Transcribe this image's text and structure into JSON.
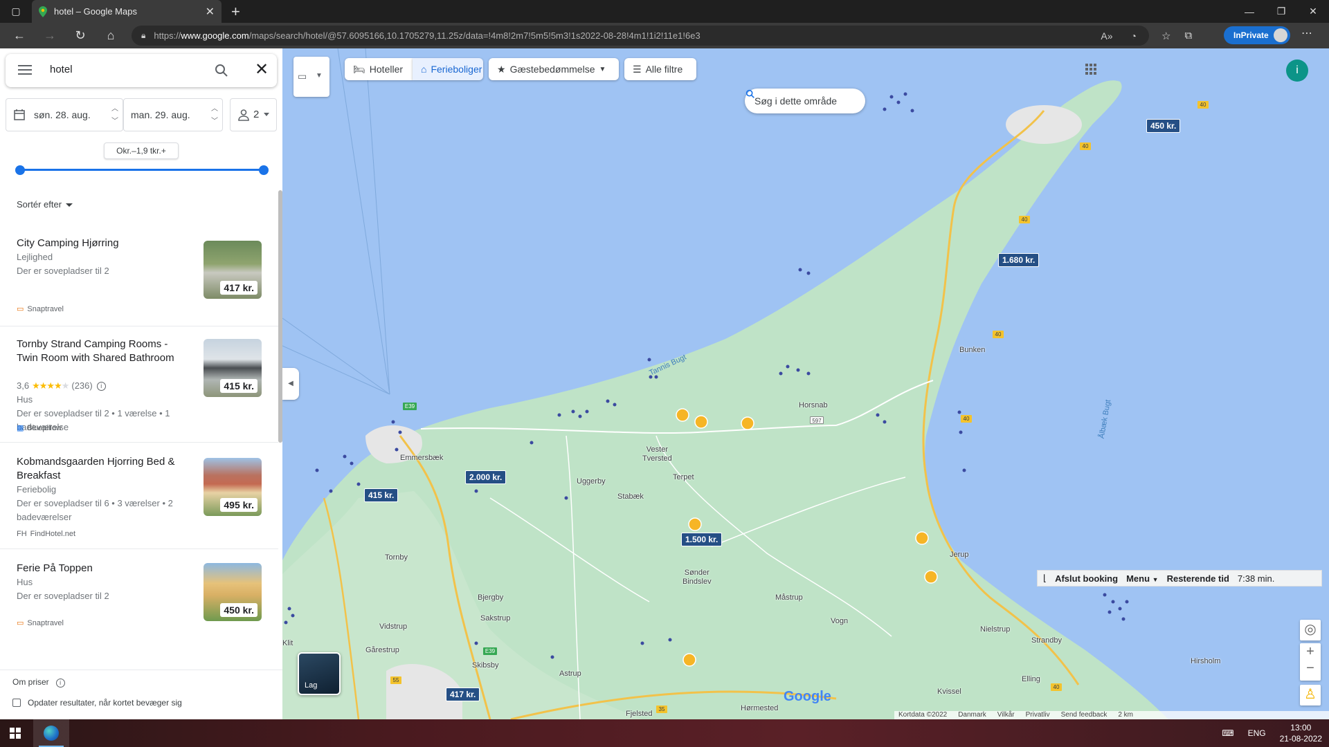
{
  "browser": {
    "tab_title": "hotel – Google Maps",
    "url_prefix": "https://",
    "url_host": "www.google.com",
    "url_path": "/maps/search/hotel/@57.6095166,10.1705279,11.25z/data=!4m8!2m7!5m5!5m3!1s2022-08-28!4m1!1i2!11e1!6e3",
    "inprivate_label": "InPrivate"
  },
  "search": {
    "query": "hotel"
  },
  "dates": {
    "checkin": "søn. 28. aug.",
    "checkout": "man. 29. aug.",
    "guests": "2"
  },
  "price_filter": {
    "label": "Okr.–1,9 tkr.+"
  },
  "sort": {
    "label": "Sortér efter"
  },
  "listings": [
    {
      "name": "City Camping Hjørring",
      "type": "Lejlighed",
      "details": "Der er sovepladser til 2",
      "price": "417 kr.",
      "source": "Snaptravel"
    },
    {
      "name": "Tornby Strand Camping Rooms - Twin Room with Shared Bathroom",
      "rating": "3,6",
      "reviews": "(236)",
      "type": "Hus",
      "details": "Der er sovepladser til 2 • 1 værelse • 1 badeværelse",
      "price": "415 kr.",
      "source": "Bluepillow"
    },
    {
      "name": "Kobmandsgaarden Hjorring Bed & Breakfast",
      "type": "Feriebolig",
      "details": "Der er sovepladser til 6 • 3 værelser • 2 badeværelser",
      "price": "495 kr.",
      "source": "FindHotel.net"
    },
    {
      "name": "Ferie På Toppen",
      "type": "Hus",
      "details": "Der er sovepladser til 2",
      "price": "450 kr.",
      "source": "Snaptravel"
    }
  ],
  "bottom": {
    "about_prices": "Om priser",
    "update_results": "Opdater resultater, når kortet bevæger sig"
  },
  "map": {
    "chips": {
      "hotels": "Hoteller",
      "holiday_homes": "Ferieboliger",
      "guest_rating": "Gæstebedømmelse",
      "all_filters": "Alle filtre"
    },
    "search_area": "Søg i dette område",
    "profile_initial": "i",
    "layers_label": "Lag",
    "google_logo": "Google",
    "price_tags": {
      "t1": "450 kr.",
      "t2": "1.680 kr.",
      "t3": "2.000 kr.",
      "t4": "415 kr.",
      "t5": "1.500 kr.",
      "t6": "417 kr."
    },
    "places": {
      "bunken": "Bunken",
      "horsnab": "Horsnab",
      "vester_tversted": "Vester\nTversted",
      "emmersbaek": "Emmersbæk",
      "uggerby": "Uggerby",
      "terpet": "Terpet",
      "stabaek": "Stabæk",
      "tornby": "Tornby",
      "sonder_bindslev": "Sønder\nBindslev",
      "jerup": "Jerup",
      "bjergby": "Bjergby",
      "sakstrup": "Sakstrup",
      "vidstrup": "Vidstrup",
      "garestrup": "Gårestrup",
      "skibsby": "Skibsby",
      "astrup": "Astrup",
      "mastrup": "Måstrup",
      "vogn": "Vogn",
      "nielstrup": "Nielstrup",
      "strandby": "Strandby",
      "hirsholm": "Hirsholm",
      "elling": "Elling",
      "kvissel": "Kvissel",
      "hormested": "Hørmested",
      "fjelsted": "Fjelsted",
      "klit": "Klit"
    },
    "water": {
      "tannis": "Tannis Bugt",
      "aalbaek": "Ålbæk Bugt"
    },
    "roads": {
      "r40": "40",
      "r597": "597",
      "r55": "55",
      "r35": "35",
      "e39": "E39"
    },
    "booking": {
      "end": "Afslut booking",
      "menu": "Menu",
      "remaining": "Resterende tid",
      "time": "7:38 min."
    },
    "attribution": {
      "data": "Kortdata ©2022",
      "country": "Danmark",
      "terms": "Vilkår",
      "privacy": "Privatliv",
      "feedback": "Send feedback",
      "scale": "2 km"
    }
  },
  "taskbar": {
    "lang": "ENG",
    "time": "13:00",
    "date": "21-08-2022"
  }
}
